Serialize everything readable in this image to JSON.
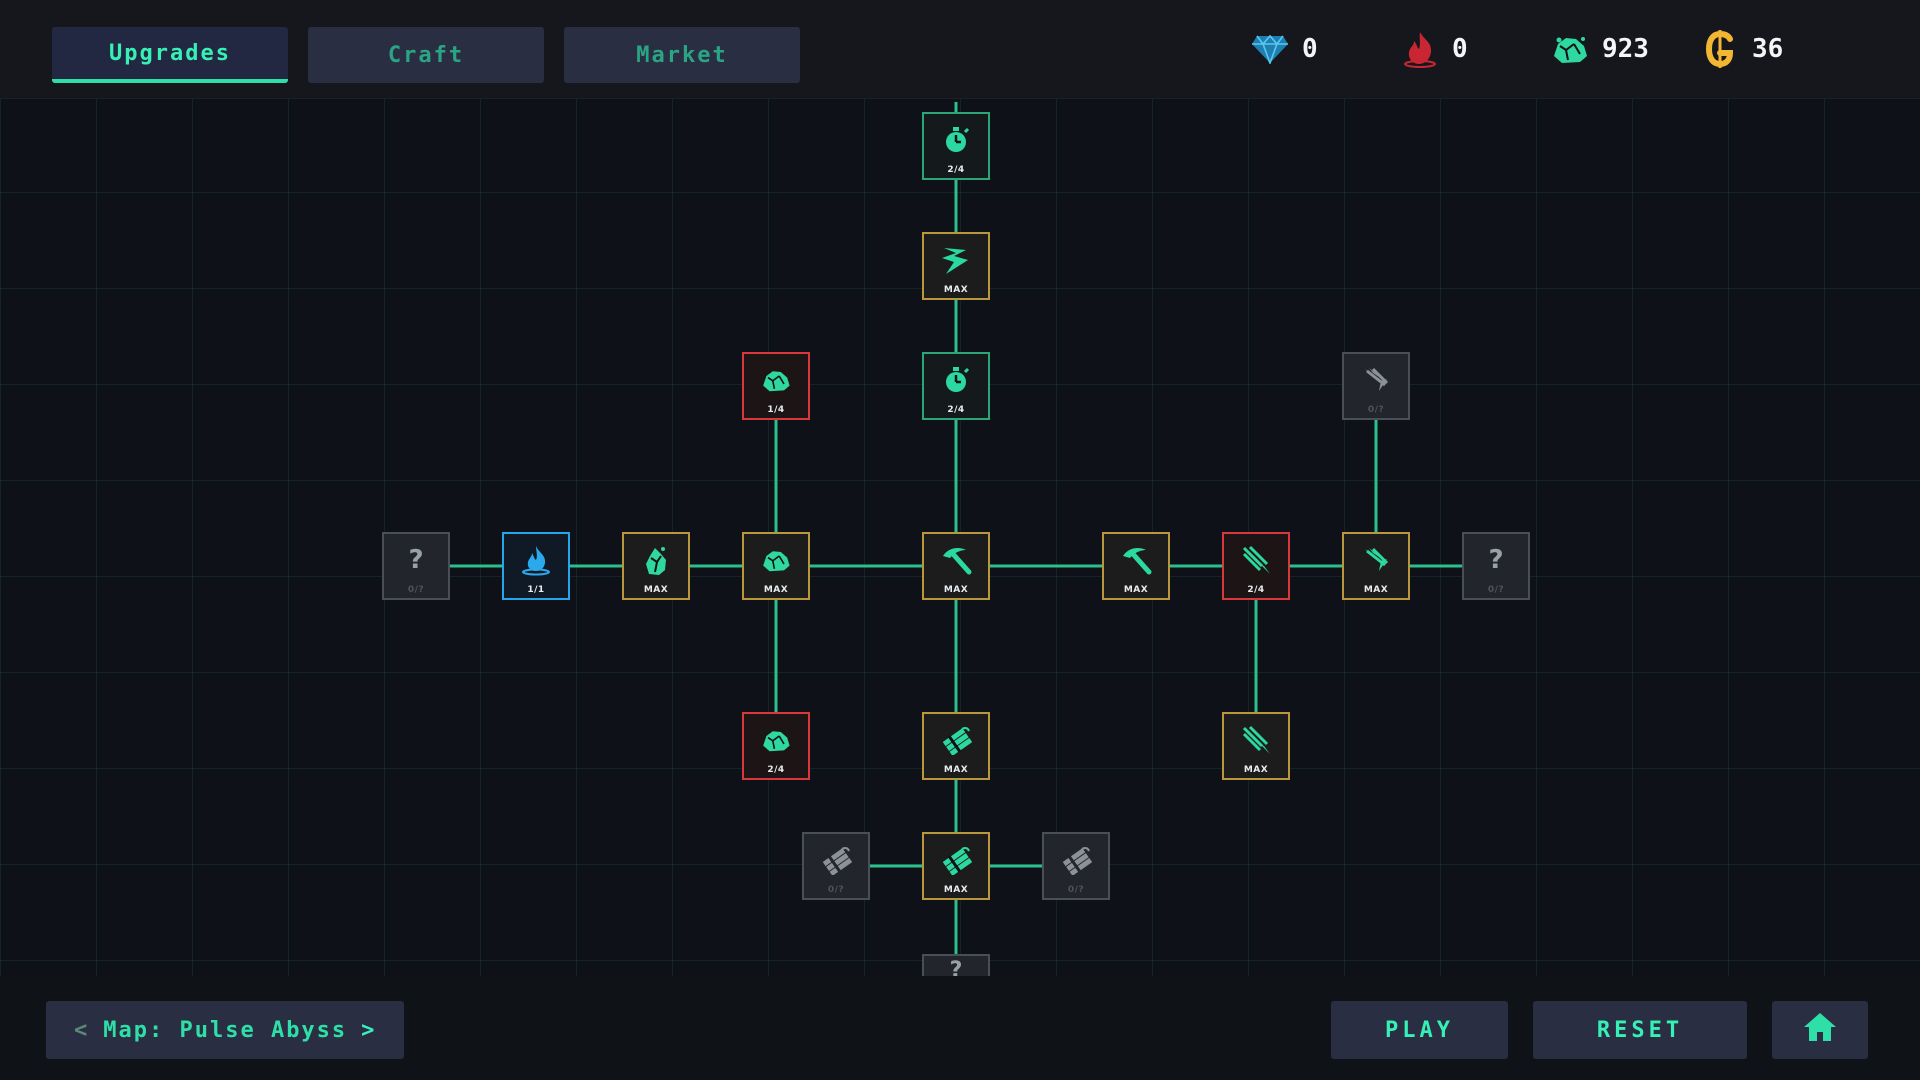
{
  "tabs": [
    {
      "label": "Upgrades",
      "active": true
    },
    {
      "label": "Craft",
      "active": false
    },
    {
      "label": "Market",
      "active": false
    }
  ],
  "resources": [
    {
      "icon": "diamond-icon",
      "value": "0",
      "color": "#2aa3d8"
    },
    {
      "icon": "flame-icon",
      "value": "0",
      "color": "#d8303a"
    },
    {
      "icon": "ore-icon",
      "value": "923",
      "color": "#36e0a8"
    },
    {
      "icon": "gold-coin-icon",
      "value": "36",
      "color": "#f2b632"
    }
  ],
  "tree": {
    "nodes": [
      {
        "id": "timer-top",
        "icon": "stopwatch-icon",
        "label": "2/4",
        "state": "partial"
      },
      {
        "id": "bolt",
        "icon": "lightning-icon",
        "label": "MAX",
        "state": "max"
      },
      {
        "id": "timer-mid",
        "icon": "stopwatch-icon",
        "label": "2/4",
        "state": "partial"
      },
      {
        "id": "ore-up",
        "icon": "ore-icon",
        "label": "1/4",
        "state": "red"
      },
      {
        "id": "claw-locked",
        "icon": "claw-icon",
        "label": "0/?",
        "state": "locked"
      },
      {
        "id": "mystery-left",
        "icon": "question-icon",
        "label": "0/?",
        "state": "mystery"
      },
      {
        "id": "fire-blue",
        "icon": "blue-flame-icon",
        "label": "1/1",
        "state": "blue"
      },
      {
        "id": "ore-cluster",
        "icon": "ore-cluster-icon",
        "label": "MAX",
        "state": "max"
      },
      {
        "id": "ore-center-left",
        "icon": "ore-icon",
        "label": "MAX",
        "state": "max"
      },
      {
        "id": "pickaxe-center",
        "icon": "pickaxe-icon",
        "label": "MAX",
        "state": "max"
      },
      {
        "id": "pickaxe-right",
        "icon": "pickaxe-icon",
        "label": "MAX",
        "state": "max"
      },
      {
        "id": "slash-red",
        "icon": "slash-icon",
        "label": "2/4",
        "state": "red"
      },
      {
        "id": "claw-right",
        "icon": "claw-icon",
        "label": "MAX",
        "state": "max"
      },
      {
        "id": "mystery-right",
        "icon": "question-icon",
        "label": "0/?",
        "state": "mystery"
      },
      {
        "id": "ore-down",
        "icon": "ore-icon",
        "label": "2/4",
        "state": "red"
      },
      {
        "id": "dynamite-upper",
        "icon": "dynamite-icon",
        "label": "MAX",
        "state": "max"
      },
      {
        "id": "slash-down",
        "icon": "slash-icon",
        "label": "MAX",
        "state": "max"
      },
      {
        "id": "dynamite-locked-left",
        "icon": "dynamite-icon",
        "label": "0/?",
        "state": "locked"
      },
      {
        "id": "dynamite-lower",
        "icon": "dynamite-icon",
        "label": "MAX",
        "state": "max"
      },
      {
        "id": "dynamite-locked-right",
        "icon": "dynamite-icon",
        "label": "0/?",
        "state": "locked"
      }
    ],
    "bottom_node_label": "?",
    "colors": {
      "connector": "#2bc08c",
      "max": "#b9973c",
      "red": "#d8383b",
      "blue": "#26a6ea",
      "partial": "#2aa677",
      "locked": "#4a4e58"
    }
  },
  "map": {
    "prev": "<",
    "label": "Map: Pulse Abyss",
    "next": ">"
  },
  "buttons": {
    "play": "PLAY",
    "reset": "RESET"
  },
  "home_icon": "home-icon"
}
